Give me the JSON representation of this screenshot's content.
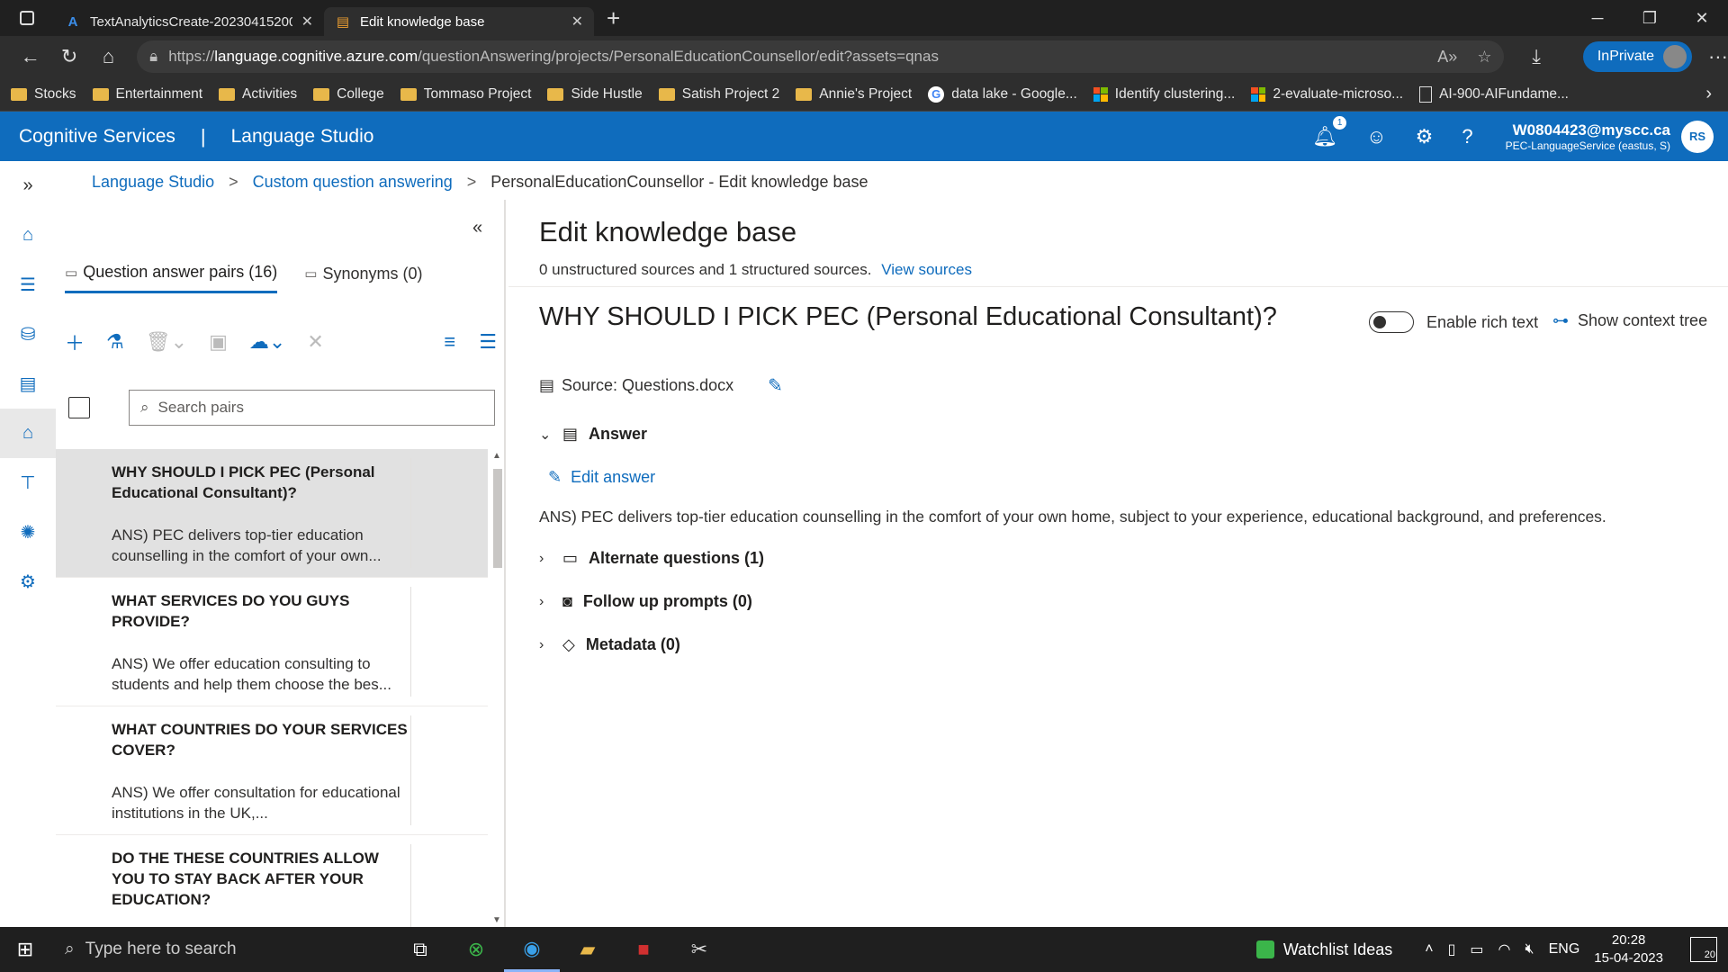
{
  "browser": {
    "tabs": [
      {
        "title": "TextAnalyticsCreate-20230415200",
        "favicon": "azure-icon",
        "active": false
      },
      {
        "title": "Edit knowledge base",
        "favicon": "language-studio-icon",
        "active": true
      }
    ],
    "url_prefix": "https://",
    "url_host": "language.cognitive.azure.com",
    "url_path": "/questionAnswering/projects/PersonalEducationCounsellor/edit?assets=qnas",
    "inprivate_label": "InPrivate"
  },
  "bookmarks": [
    {
      "label": "Stocks",
      "icon": "folder-icon"
    },
    {
      "label": "Entertainment",
      "icon": "folder-icon"
    },
    {
      "label": "Activities",
      "icon": "folder-icon"
    },
    {
      "label": "College",
      "icon": "folder-icon"
    },
    {
      "label": "Tommaso Project",
      "icon": "folder-icon"
    },
    {
      "label": "Side Hustle",
      "icon": "folder-icon"
    },
    {
      "label": "Satish Project 2",
      "icon": "folder-icon"
    },
    {
      "label": "Annie's Project",
      "icon": "folder-icon"
    },
    {
      "label": "data lake - Google...",
      "icon": "google-icon"
    },
    {
      "label": "Identify clustering...",
      "icon": "microsoft-icon"
    },
    {
      "label": "2-evaluate-microso...",
      "icon": "microsoft-icon"
    },
    {
      "label": "AI-900-AIFundame...",
      "icon": "document-icon"
    }
  ],
  "header": {
    "brand": "Cognitive Services",
    "separator": "|",
    "product": "Language Studio",
    "notification_count": "1",
    "user_email": "W0804423@myscc.ca",
    "user_resource": "PEC-LanguageService (eastus, S)",
    "user_initials": "RS"
  },
  "breadcrumb": {
    "item1": "Language Studio",
    "item2": "Custom question answering",
    "current": "PersonalEducationCounsellor - Edit knowledge base",
    "sep": ">"
  },
  "leftpane": {
    "tab_qa": "Question answer pairs (16)",
    "tab_synonyms": "Synonyms (0)",
    "search_placeholder": "Search pairs",
    "items": [
      {
        "question": "WHY SHOULD I PICK PEC (Personal Educational Consultant)?",
        "answer": "ANS) PEC delivers top-tier education counselling in the comfort of your own..."
      },
      {
        "question": "WHAT SERVICES DO YOU GUYS PROVIDE?",
        "answer": "ANS) We offer education consulting to students and help them choose the bes..."
      },
      {
        "question": "WHAT COUNTRIES DO YOUR SERVICES COVER?",
        "answer": "ANS) We offer consultation for educational institutions in the UK,..."
      },
      {
        "question": "DO THE THESE COUNTRIES ALLOW YOU TO STAY BACK AFTER YOUR EDUCATION?",
        "answer": ""
      }
    ]
  },
  "main": {
    "title": "Edit knowledge base",
    "sources_text": "0 unstructured sources and 1 structured sources.",
    "view_sources": "View sources",
    "question": "WHY SHOULD I PICK PEC (Personal Educational Consultant)?",
    "rich_text_label": "Enable rich text",
    "context_tree_label": "Show context tree",
    "source_label": "Source: Questions.docx",
    "answer_label": "Answer",
    "edit_answer": "Edit answer",
    "answer_text": "ANS) PEC delivers top-tier education counselling in the comfort of your own home, subject to your experience, educational background, and preferences.",
    "alternate_questions": "Alternate questions (1)",
    "follow_up": "Follow up prompts (0)",
    "metadata": "Metadata (0)"
  },
  "taskbar": {
    "search_placeholder": "Type here to search",
    "watchlist": "Watchlist Ideas",
    "language": "ENG",
    "time": "20:28",
    "date": "15-04-2023",
    "notifications": "20"
  },
  "colors": {
    "accent": "#0f6cbd",
    "selected_row": "#e1e1e1"
  }
}
